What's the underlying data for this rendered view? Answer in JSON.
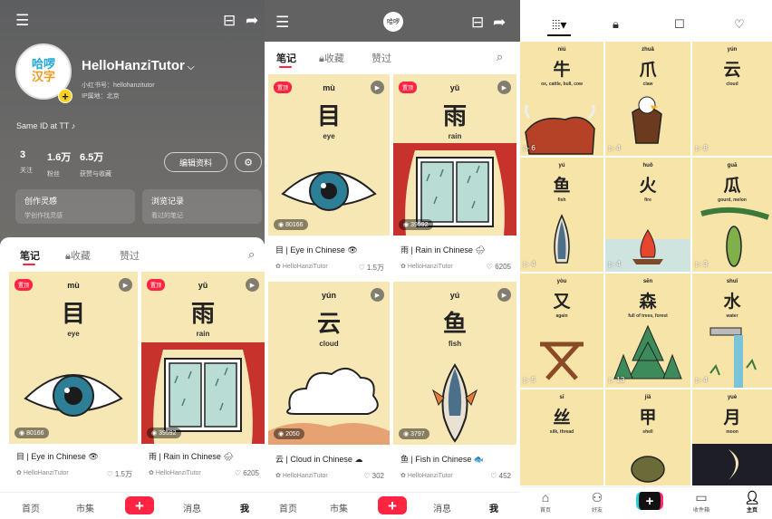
{
  "profile": {
    "username": "HelloHanziTutor",
    "username_chevron": "⌵",
    "avatar_line1": "哈啰",
    "avatar_line2": "汉字",
    "id_line": "小红书号：hellohanzitutor",
    "ip_line": "IP属地：北京",
    "bio": "Same ID at TT ♪",
    "stats": [
      {
        "value": "3",
        "label": "关注"
      },
      {
        "value": "1.6万",
        "label": "粉丝"
      },
      {
        "value": "6.5万",
        "label": "获赞与收藏"
      }
    ],
    "edit_label": "编辑资料",
    "cards": [
      {
        "title": "创作灵感",
        "subtitle": "学创作找灵感"
      },
      {
        "title": "浏览记录",
        "subtitle": "看过的笔记"
      }
    ]
  },
  "tabs": {
    "notes": "笔记",
    "collect": "收藏",
    "liked": "赞过"
  },
  "notes": [
    {
      "pinyin": "mù",
      "hanzi": "目",
      "gloss": "eye",
      "pinned": "置顶",
      "views": "80166",
      "title": "目 | Eye in Chinese",
      "emoji": "👁",
      "author": "HelloHanziTutor",
      "likes": "1.5万",
      "bg": "#f7e7b5"
    },
    {
      "pinyin": "yǔ",
      "hanzi": "雨",
      "gloss": "rain",
      "pinned": "置顶",
      "views": "39592",
      "title": "雨 | Rain in Chinese",
      "emoji": "🌧",
      "author": "HelloHanziTutor",
      "likes": "6205",
      "bg": "#f7e7b5"
    },
    {
      "pinyin": "yún",
      "hanzi": "云",
      "gloss": "cloud",
      "pinned": "",
      "views": "2050",
      "title": "云 | Cloud in Chinese",
      "emoji": "☁",
      "author": "HelloHanziTutor",
      "likes": "302",
      "bg": "#f7e7b5"
    },
    {
      "pinyin": "yú",
      "hanzi": "鱼",
      "gloss": "fish",
      "pinned": "",
      "views": "3797",
      "title": "鱼 | Fish in Chinese",
      "emoji": "🐟",
      "author": "HelloHanziTutor",
      "likes": "452",
      "bg": "#f7e7b5"
    }
  ],
  "nav_xhs": {
    "home": "首页",
    "market": "市集",
    "plus": "+",
    "messages": "消息",
    "me": "我"
  },
  "tiles": [
    {
      "pinyin": "niú",
      "hanzi": "牛",
      "gloss": "ox, cattle, bull, cow",
      "count": "▷ 6"
    },
    {
      "pinyin": "zhuǎ",
      "hanzi": "爪",
      "gloss": "claw",
      "count": "▷ 4"
    },
    {
      "pinyin": "yún",
      "hanzi": "云",
      "gloss": "cloud",
      "count": "▷ 8"
    },
    {
      "pinyin": "yú",
      "hanzi": "鱼",
      "gloss": "fish",
      "count": "▷ 4"
    },
    {
      "pinyin": "huǒ",
      "hanzi": "火",
      "gloss": "fire",
      "count": "▷ 4"
    },
    {
      "pinyin": "guā",
      "hanzi": "瓜",
      "gloss": "gourd, melon",
      "count": "▷ 3"
    },
    {
      "pinyin": "yòu",
      "hanzi": "又",
      "gloss": "again",
      "count": "▷ 5"
    },
    {
      "pinyin": "sēn",
      "hanzi": "森",
      "gloss": "full of trees, forest",
      "count": "▷ 13"
    },
    {
      "pinyin": "shuǐ",
      "hanzi": "水",
      "gloss": "water",
      "count": "▷ 4"
    },
    {
      "pinyin": "sī",
      "hanzi": "丝",
      "gloss": "silk, thread",
      "count": ""
    },
    {
      "pinyin": "jiǎ",
      "hanzi": "甲",
      "gloss": "shell",
      "count": ""
    },
    {
      "pinyin": "yuè",
      "hanzi": "月",
      "gloss": "moon",
      "count": ""
    }
  ],
  "nav_tt": {
    "home": "首页",
    "friends": "好友",
    "plus": "+",
    "inbox": "收件箱",
    "me": "主页"
  },
  "colors": {
    "accent": "#ff2442",
    "tile_bg": "#f7e4a8"
  }
}
